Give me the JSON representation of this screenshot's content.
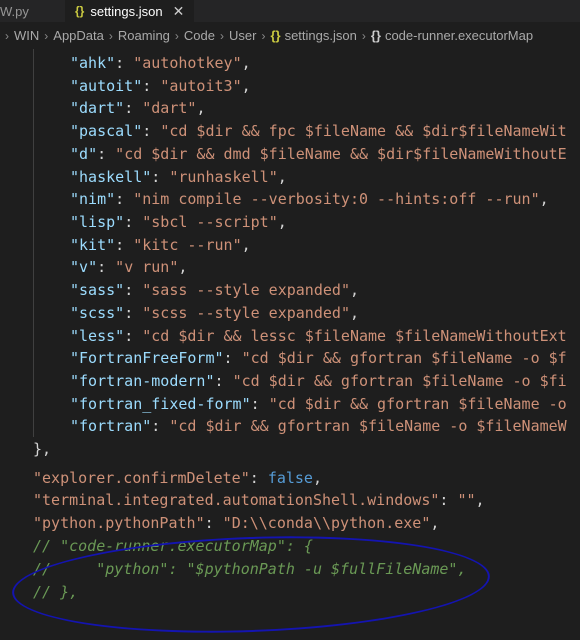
{
  "tabs": [
    {
      "label": "W.py"
    },
    {
      "label": "settings.json",
      "icon": "{}",
      "close": "✕"
    }
  ],
  "breadcrumb": [
    "WIN",
    "AppData",
    "Roaming",
    "Code",
    "User",
    "settings.json",
    "code-runner.executorMap"
  ],
  "code": {
    "runner": [
      {
        "key": "ahk",
        "value": "autohotkey"
      },
      {
        "key": "autoit",
        "value": "autoit3"
      },
      {
        "key": "dart",
        "value": "dart"
      },
      {
        "key": "pascal",
        "value": "cd $dir && fpc $fileName && $dir$fileNameWit"
      },
      {
        "key": "d",
        "value": "cd $dir && dmd $fileName && $dir$fileNameWithoutE"
      },
      {
        "key": "haskell",
        "value": "runhaskell"
      },
      {
        "key": "nim",
        "value": "nim compile --verbosity:0 --hints:off --run"
      },
      {
        "key": "lisp",
        "value": "sbcl --script"
      },
      {
        "key": "kit",
        "value": "kitc --run"
      },
      {
        "key": "v",
        "value": "v run"
      },
      {
        "key": "sass",
        "value": "sass --style expanded"
      },
      {
        "key": "scss",
        "value": "scss --style expanded"
      },
      {
        "key": "less",
        "value": "cd $dir && lessc $fileName $fileNameWithoutExt"
      },
      {
        "key": "FortranFreeForm",
        "value": "cd $dir && gfortran $fileName -o $f"
      },
      {
        "key": "fortran-modern",
        "value": "cd $dir && gfortran $fileName -o $fi"
      },
      {
        "key": "fortran_fixed-form",
        "value": "cd $dir && gfortran $fileName -o"
      },
      {
        "key": "fortran",
        "value": "cd $dir && gfortran $fileName -o $fileNameW"
      }
    ],
    "closing": "},",
    "settings": [
      {
        "key": "explorer.confirmDelete",
        "value": "false",
        "kind": "keyword"
      },
      {
        "key": "terminal.integrated.automationShell.windows",
        "value": "",
        "kind": "string"
      },
      {
        "key": "python.pythonPath",
        "value": "D:\\\\conda\\\\python.exe",
        "kind": "string"
      }
    ],
    "comments": [
      "// \"code-runner.executorMap\": {",
      "//     \"python\": \"$pythonPath -u $fullFileName\",",
      "// },"
    ]
  },
  "colors": {
    "background": "#1e1e1e",
    "property": "#9cdcfe",
    "string": "#ce9178",
    "keyword": "#569cd6",
    "comment": "#6a9955",
    "annotation": "#1414b0"
  }
}
